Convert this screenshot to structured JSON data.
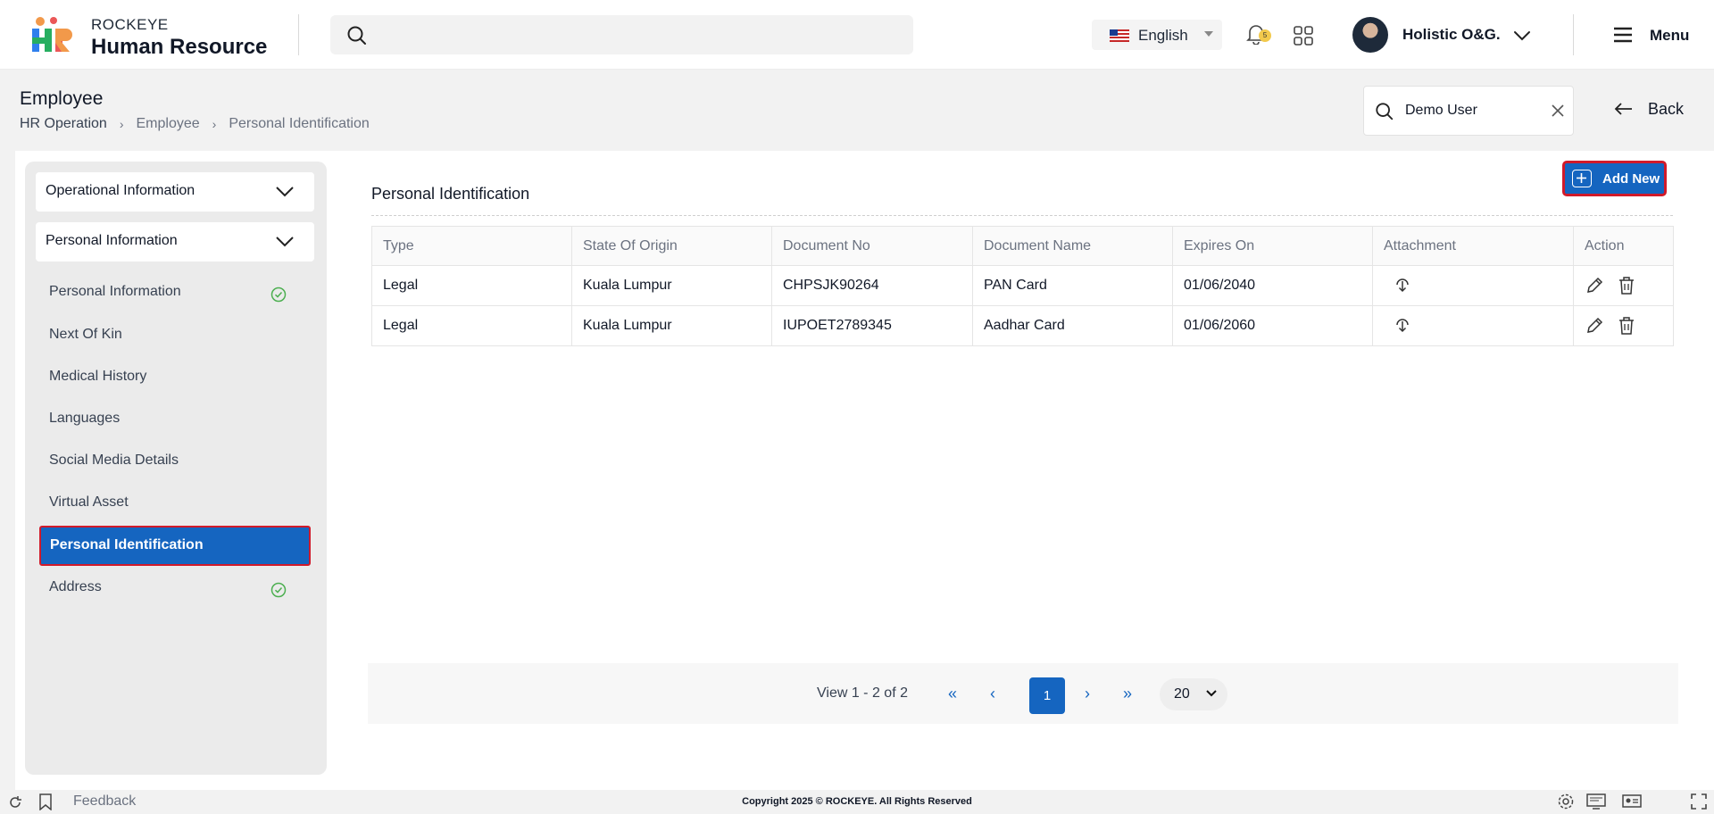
{
  "brand": {
    "small": "ROCKEYE",
    "big": "Human Resource"
  },
  "language": {
    "label": "English"
  },
  "notifications": {
    "count": "5"
  },
  "user": {
    "name": "Holistic O&G."
  },
  "menu": {
    "label": "Menu"
  },
  "page": {
    "title": "Employee",
    "breadcrumb": [
      "HR Operation",
      "Employee",
      "Personal Identification"
    ]
  },
  "employee_search": {
    "value": "Demo User"
  },
  "back": {
    "label": "Back"
  },
  "sidebar": {
    "accordions": [
      "Operational Information",
      "Personal Information"
    ],
    "items": [
      {
        "label": "Personal Information",
        "checked": true
      },
      {
        "label": "Next Of Kin",
        "checked": false
      },
      {
        "label": "Medical History",
        "checked": false
      },
      {
        "label": "Languages",
        "checked": false
      },
      {
        "label": "Social Media Details",
        "checked": false
      },
      {
        "label": "Virtual Asset",
        "checked": false
      },
      {
        "label": "Personal Identification",
        "checked": false,
        "active": true
      },
      {
        "label": "Address",
        "checked": true
      }
    ]
  },
  "section": {
    "title": "Personal Identification",
    "add_label": "Add New"
  },
  "table": {
    "columns": [
      "Type",
      "State Of Origin",
      "Document No",
      "Document Name",
      "Expires On",
      "Attachment",
      "Action"
    ],
    "rows": [
      [
        "Legal",
        "Kuala Lumpur",
        "CHPSJK90264",
        "PAN Card",
        "01/06/2040"
      ],
      [
        "Legal",
        "Kuala Lumpur",
        "IUPOET2789345",
        "Aadhar Card",
        "01/06/2060"
      ]
    ]
  },
  "pagination": {
    "view_text": "View 1 - 2 of 2",
    "current_page": "1",
    "page_size": "20"
  },
  "footer": {
    "feedback": "Feedback",
    "copyright": "Copyright 2025 © ROCKEYE. All Rights Reserved"
  },
  "colors": {
    "primary": "#1565c0",
    "highlight_border": "#d11a2a",
    "check": "#4caf50"
  }
}
